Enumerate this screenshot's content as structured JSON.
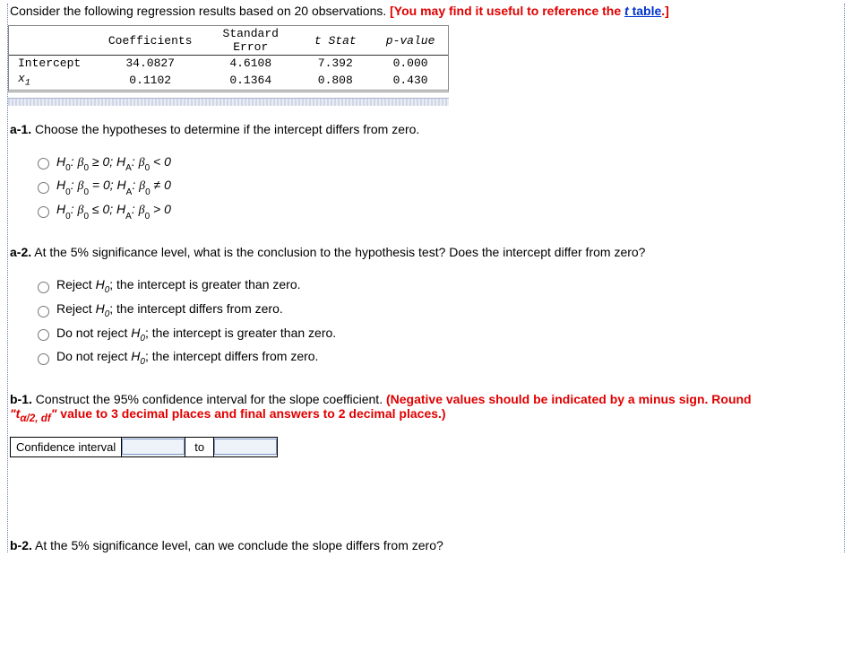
{
  "intro": {
    "text": "Consider the following regression results based on 20 observations. ",
    "hint_prefix": "[You may find it useful to reference the ",
    "link_label_t": "t",
    "link_label_rest": " table",
    "hint_suffix": ".]"
  },
  "reg_table": {
    "headers": {
      "coefficients": "Coefficients",
      "stderr_line1": "Standard",
      "stderr_line2": "Error",
      "tstat": "t Stat",
      "pvalue": "p-value"
    },
    "rows": [
      {
        "label": "Intercept",
        "coef": "34.0827",
        "se": "4.6108",
        "t": "7.392",
        "p": "0.000"
      },
      {
        "label_html": "x1",
        "coef": "0.1102",
        "se": "0.1364",
        "t": "0.808",
        "p": "0.430"
      }
    ]
  },
  "a1": {
    "label_bold": "a-1.",
    "text": " Choose the hypotheses to determine if the intercept differs from zero.",
    "options": [
      "H0: β0 ≥ 0; HA: β0 < 0",
      "H0: β0 = 0; HA: β0 ≠ 0",
      "H0: β0 ≤ 0; HA: β0 > 0"
    ]
  },
  "a2": {
    "label_bold": "a-2.",
    "text": " At the 5% significance level, what is the conclusion to the hypothesis test? Does the intercept differ from zero?",
    "options": [
      {
        "pre": "Reject ",
        "post": "; the intercept is greater than zero."
      },
      {
        "pre": "Reject ",
        "post": "; the intercept differs from zero."
      },
      {
        "pre": "Do not reject ",
        "post": "; the intercept is greater than zero."
      },
      {
        "pre": "Do not reject ",
        "post": "; the intercept differs from zero."
      }
    ],
    "h0_label": "H0"
  },
  "b1": {
    "label_bold": "b-1.",
    "text": " Construct the 95% confidence interval for the slope coefficient. ",
    "red1": "(Negative values should be indicated by a minus sign. Round ",
    "t_expr": "\"tα/2, df\"",
    "red2": " value to 3 decimal places and final answers to 2 decimal places.)",
    "ci_label": "Confidence interval",
    "to": "to"
  },
  "b2": {
    "label_bold": "b-2.",
    "text": " At the 5% significance level, can we conclude the slope differs from zero?"
  }
}
